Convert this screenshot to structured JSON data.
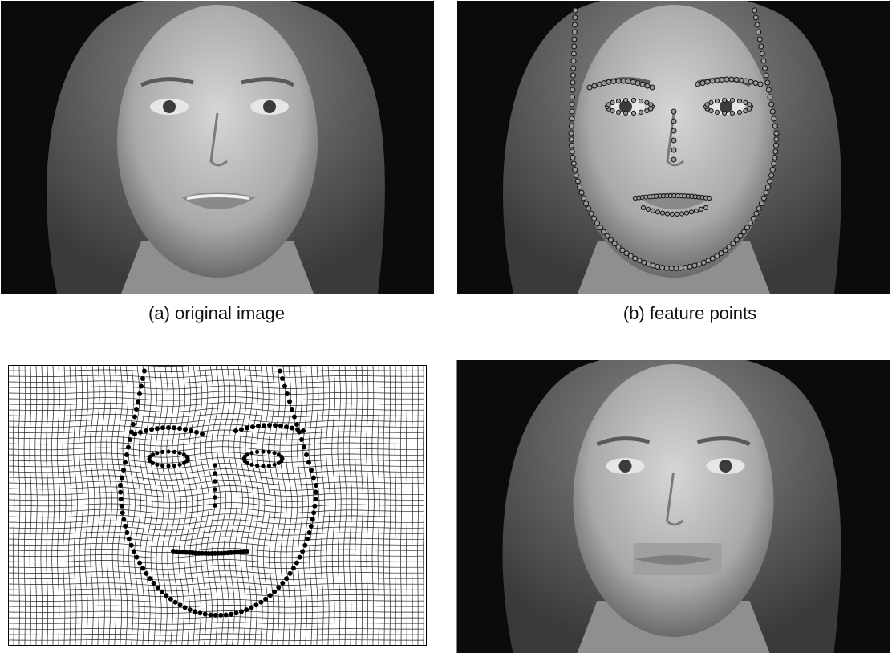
{
  "figure": {
    "panels": [
      {
        "id": "a",
        "caption": "(a) original image"
      },
      {
        "id": "b",
        "caption": "(b) feature points"
      },
      {
        "id": "c",
        "caption": ""
      },
      {
        "id": "d",
        "caption": ""
      }
    ]
  },
  "colors": {
    "background": "#0b0b0b",
    "skin": "#b9b9b9",
    "hair": "#6e6e6e",
    "marker_fill": "#9a9a9a",
    "mesh_line": "#222222",
    "dots": "#000000"
  }
}
